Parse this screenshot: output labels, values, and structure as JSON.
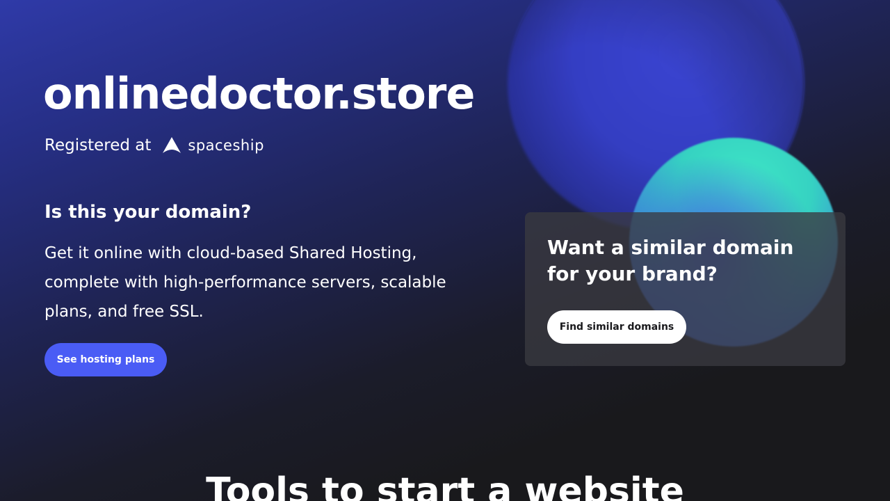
{
  "hero": {
    "domain": "onlinedoctor.store",
    "registered_label": "Registered at",
    "registrar_name": "spaceship",
    "registrar_icon": "spaceship-logo-icon"
  },
  "hosting": {
    "question": "Is this your domain?",
    "description": "Get it online with cloud-based Shared Hosting, complete with high-performance servers, scalable plans, and free SSL.",
    "cta_label": "See hosting plans"
  },
  "similar_card": {
    "title": "Want a similar domain for your brand?",
    "cta_label": "Find similar domains"
  },
  "tools": {
    "heading": "Tools to start a website"
  },
  "colors": {
    "primary_button": "#4a5cf5",
    "background": "#19191c",
    "accent_blue": "#3c46d8",
    "accent_teal": "#3fe8c6"
  }
}
